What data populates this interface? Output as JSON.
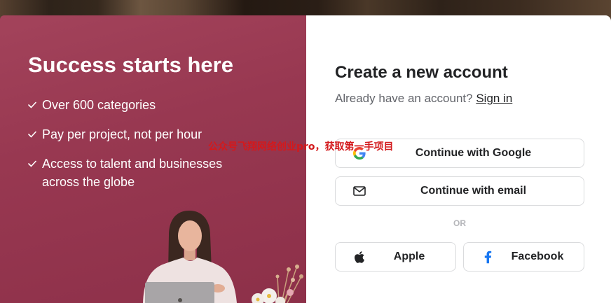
{
  "left_panel": {
    "title": "Success starts here",
    "feature_icon": "check-icon",
    "features": [
      "Over 600 categories",
      "Pay per project, not per hour",
      "Access to talent and businesses across the globe"
    ]
  },
  "right_panel": {
    "title": "Create a new account",
    "signin_prompt": "Already have an account?",
    "signin_link": "Sign in",
    "buttons": {
      "google": {
        "label": "Continue with Google",
        "icon": "google-icon"
      },
      "email": {
        "label": "Continue with email",
        "icon": "mail-icon"
      },
      "apple": {
        "label": "Apple",
        "icon": "apple-icon"
      },
      "facebook": {
        "label": "Facebook",
        "icon": "facebook-icon"
      }
    },
    "divider": "OR"
  },
  "watermark": "公众号飞翔网络创业pro，获取第一手项目",
  "colors": {
    "panel": "#98374f",
    "text_dark": "#222325",
    "text_muted": "#62646a",
    "button_border": "#dadbdd",
    "facebook_blue": "#1877f2",
    "watermark_red": "#d3191c"
  }
}
